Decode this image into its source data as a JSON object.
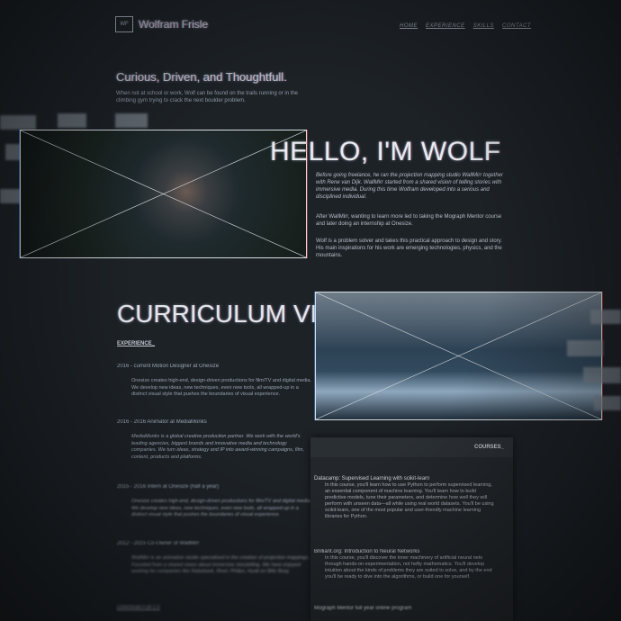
{
  "header": {
    "logo_mark": "WF",
    "site_title": "Wolfram Frisle",
    "nav": [
      "HOME",
      "EXPERIENCE",
      "SKILLS",
      "CONTACT"
    ]
  },
  "intro": {
    "tagline": "Curious, Driven, and Thoughtfull.",
    "text": "When not at school or work, Wolf can be found on the trails running or in the climbing gym trying to crack the next boulder problem."
  },
  "hello": {
    "heading": "HELLO, I'M WOLF",
    "paragraphs": [
      "Before going freelance, he ran the projection mapping studio WallMirr together with Rene van Dijk. WallMirr started from a shared vision of telling stories with immersive media. During this time Wolfram developed into a serious and disciplined individual.",
      "After WallMirr, wanting to learn more led to taking the Mograph Mentor course and later doing an internship at Onesize.",
      "Wolf is a problem solver and takes this practical approach to design and story. His main inspirations for his work are emerging technologies, physics, and the mountains."
    ]
  },
  "cv": {
    "heading": "CURRICULUM VITAE",
    "experience_label": "EXPERIENCE_",
    "jobs": [
      {
        "title": "2016 - current Motion Designer at Onesize",
        "desc": "Onesize creates high-end, design-driven productions for film/TV and digital media. We develop new ideas, new techniques, even new tools, all wrapped-up in a distinct visual style that pushes the boundaries of visual experience."
      },
      {
        "title": "2016 - 2016 Animator at MediaMonks",
        "desc": "MediaMonks is a global creative production partner. We work with the world's leading agencies, biggest brands and innovative media and technology companies. We turn ideas, strategy and IP into award-winning campaigns, film, content, products and platforms."
      },
      {
        "title": "2015 - 2016 Intern at Onesize (half a year)",
        "desc": "Onesize creates high-end, design-driven productions for film/TV and digital media. We develop new ideas, new techniques, even new tools, all wrapped-up in a distinct visual style that pushes the boundaries of visual experience."
      },
      {
        "title": "2012 - 2015 Co-Owner of WallMirr",
        "desc": "WallMirr is an animation studio specialised in the creation of projection mappings. Founded from a shared vision about immersive storytelling. We have enjoyed working for companies like Rabobank, Rivel, Philips, Hyatt en Blitz Borg."
      }
    ],
    "download_label": "Download Full CV"
  },
  "courses": {
    "label": "COURSES_",
    "items": [
      {
        "title": "Datacamp: Supervised Learning with scikit-learn",
        "desc": "In this course, you'll learn how to use Python to perform supervised learning, an essential component of machine learning. You'll learn how to build predictive models, tune their parameters, and determine how well they will perform with unseen data—all while using real world datasets. You'll be using scikit-learn, one of the most popular and user-friendly machine learning libraries for Python."
      },
      {
        "title": "Brilliant.org: Introduction to Neural Networks",
        "desc": "In this course, you'll discover the inner machinery of artificial neural nets through hands-on experimentation, not hefty mathematics. You'll develop intuition about the kinds of problems they are suited to solve, and by the end you'll be ready to dive into the algorithms, or build one for yourself."
      },
      {
        "title": "Mograph Mentor full year online program",
        "desc": ""
      }
    ]
  },
  "colors": {
    "background": "#1d2227",
    "frame": "#d8dde2",
    "text": "#c9cfd6"
  }
}
